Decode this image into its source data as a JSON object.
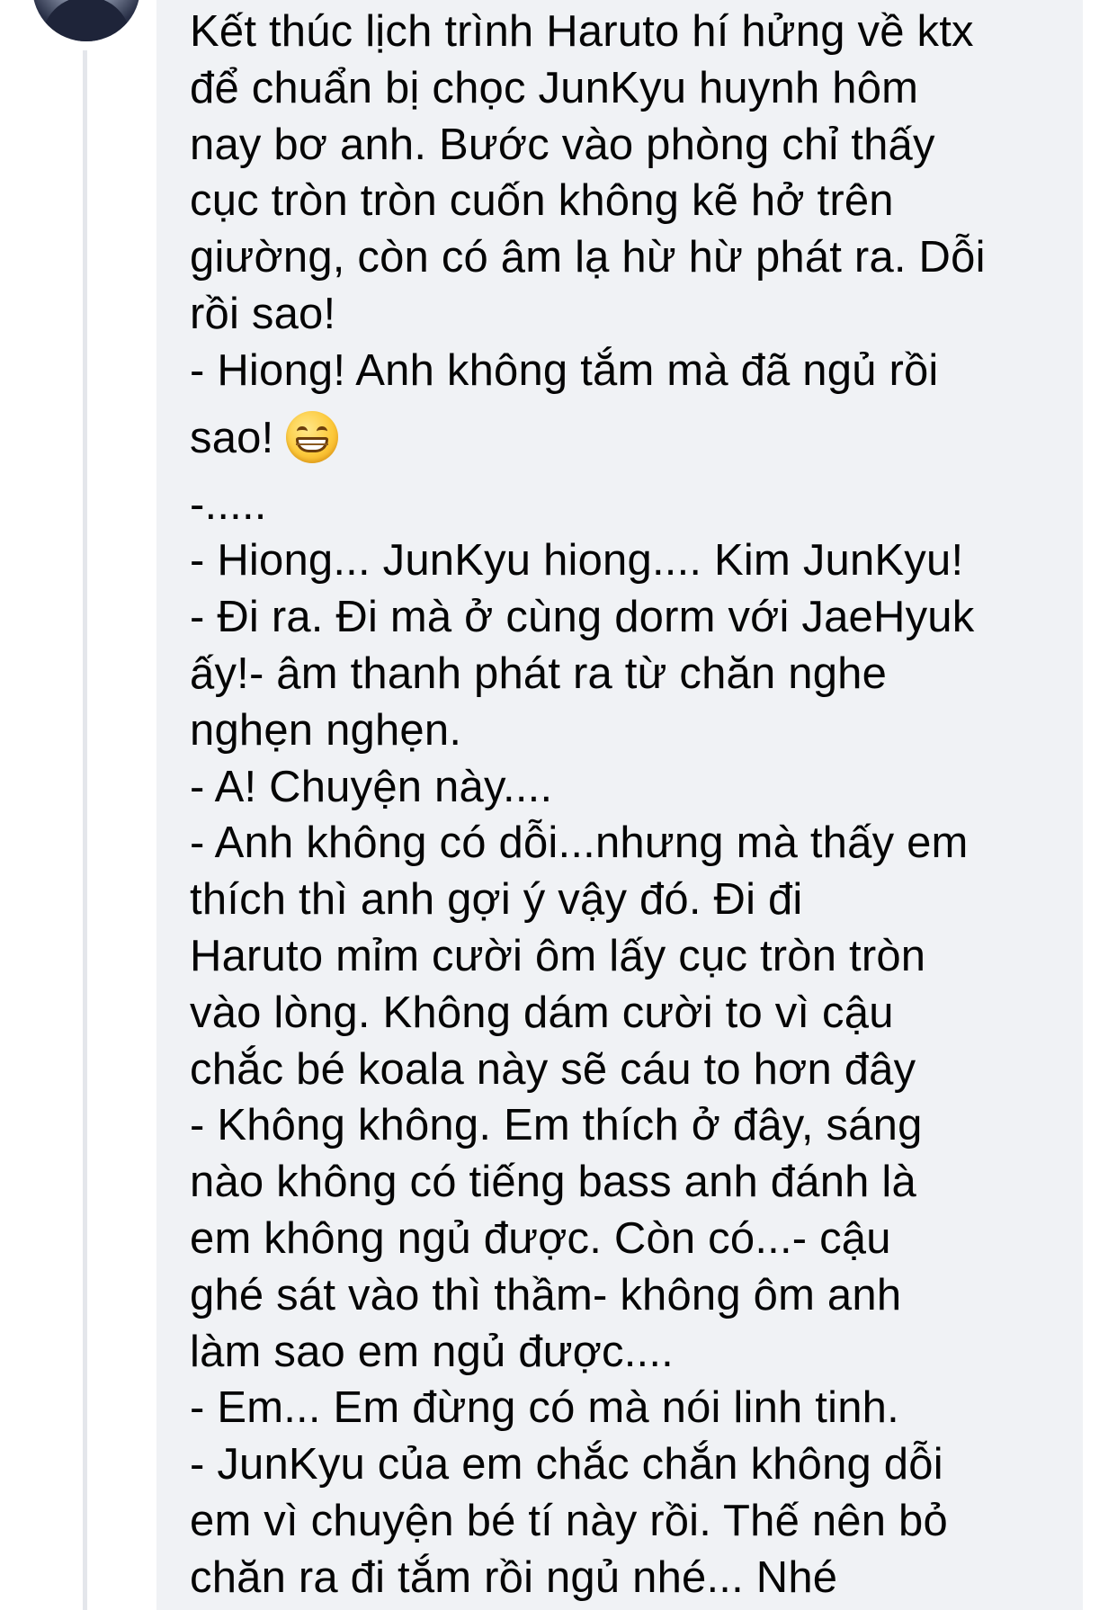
{
  "comment": {
    "bubble_color": "#f0f2f5",
    "text_color": "#050505",
    "emoji": "grinning-face-with-smiling-eyes",
    "lines": [
      "Kết thúc lịch trình Haruto hí hửng về ktx",
      "để chuẩn bị chọc JunKyu huynh hôm",
      "nay bơ anh. Bước vào phòng chỉ thấy",
      "cục tròn tròn cuốn không kẽ hở trên",
      "giường, còn có âm lạ hừ hừ phát ra. Dỗi",
      "rồi sao!",
      "- Hiong! Anh không tắm mà đã ngủ rồi",
      "sao!",
      "-.....",
      "- Hiong... JunKyu hiong.... Kim JunKyu!",
      "- Đi ra. Đi mà ở cùng dorm với JaeHyuk",
      "ấy!- âm thanh phát ra từ chăn nghe",
      "nghẹn nghẹn.",
      "- A! Chuyện này....",
      "- Anh không có dỗi...nhưng mà thấy em",
      "thích thì anh gợi ý vậy đó. Đi đi",
      "Haruto mỉm cười ôm lấy cục tròn tròn",
      "vào lòng. Không dám cười to vì cậu",
      "chắc bé koala này sẽ cáu to hơn đây",
      "- Không không. Em thích ở đây, sáng",
      "nào không có  tiếng bass anh đánh là",
      "em không ngủ được. Còn có...- cậu",
      "ghé sát vào thì thầm- không ôm anh",
      "làm sao em ngủ được....",
      "- Em... Em đừng có mà nói linh tinh.",
      "- JunKyu của em chắc chắn không dỗi",
      "em vì chuyện bé tí này rồi. Thế nên bỏ",
      "chăn ra đi tắm rồi ngủ nhé... Nhé"
    ]
  }
}
